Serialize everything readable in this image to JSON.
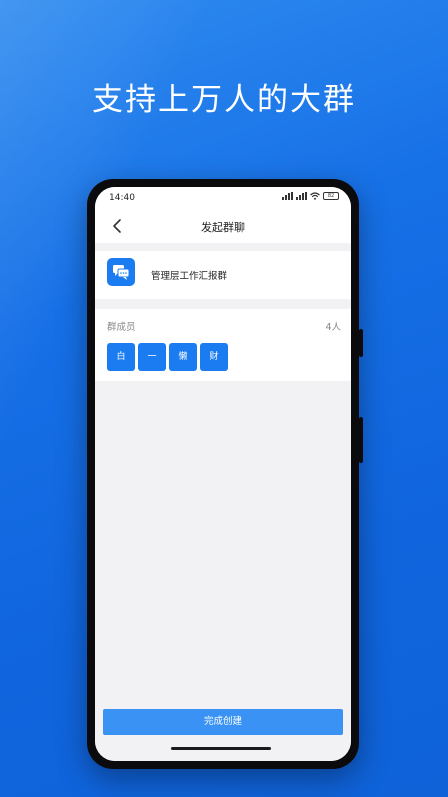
{
  "promo": {
    "headline": "支持上万人的大群"
  },
  "status_bar": {
    "time": "14:40",
    "battery": "82"
  },
  "nav": {
    "title": "发起群聊"
  },
  "group": {
    "name": "管理层工作汇报群"
  },
  "members": {
    "label": "群成员",
    "count": "4人",
    "chips": [
      "白",
      "一",
      "懒",
      "财"
    ]
  },
  "actions": {
    "complete_label": "完成创建"
  },
  "colors": {
    "background": "#1670e6",
    "accent": "#1a7cf0",
    "button": "#3a93f4"
  }
}
